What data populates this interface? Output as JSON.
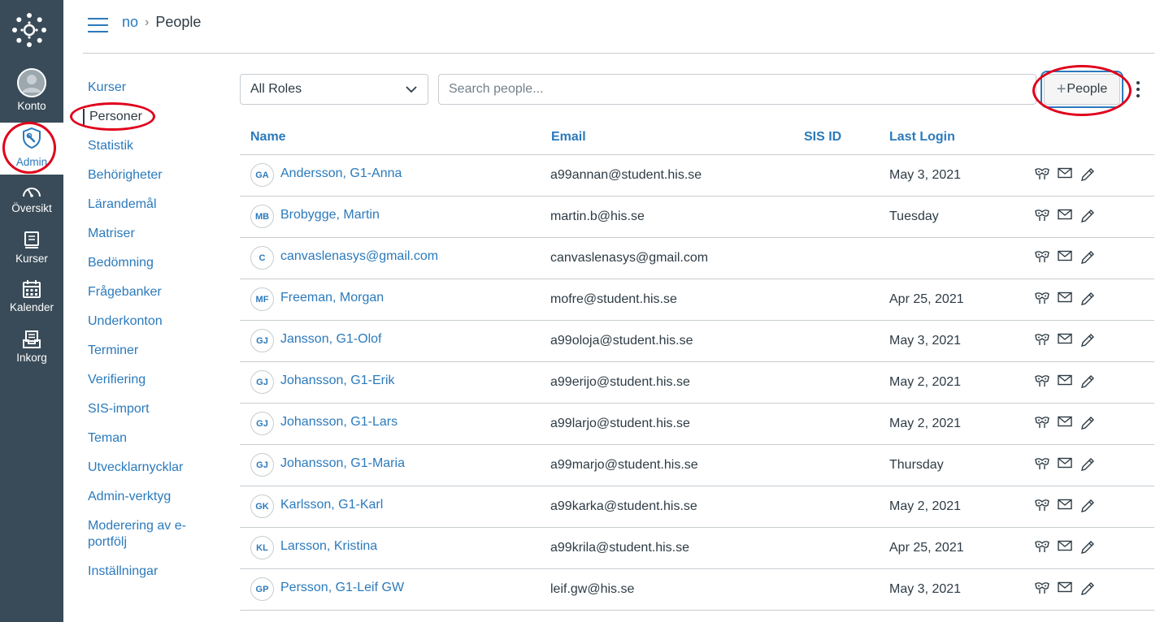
{
  "global_nav": {
    "items": [
      {
        "label": "Konto",
        "icon": "user-avatar-icon"
      },
      {
        "label": "Admin",
        "icon": "admin-shield-icon"
      },
      {
        "label": "Översikt",
        "icon": "dashboard-gauge-icon"
      },
      {
        "label": "Kurser",
        "icon": "courses-book-icon"
      },
      {
        "label": "Kalender",
        "icon": "calendar-icon"
      },
      {
        "label": "Inkorg",
        "icon": "inbox-icon"
      }
    ]
  },
  "breadcrumb": {
    "root": "no",
    "current": "People"
  },
  "sub_nav": {
    "items": [
      {
        "label": "Kurser"
      },
      {
        "label": "Personer",
        "active": true
      },
      {
        "label": "Statistik"
      },
      {
        "label": "Behörigheter"
      },
      {
        "label": "Lärandemål"
      },
      {
        "label": "Matriser"
      },
      {
        "label": "Bedömning"
      },
      {
        "label": "Frågebanker"
      },
      {
        "label": "Underkonton"
      },
      {
        "label": "Terminer"
      },
      {
        "label": "Verifiering"
      },
      {
        "label": "SIS-import"
      },
      {
        "label": "Teman"
      },
      {
        "label": "Utvecklarnycklar"
      },
      {
        "label": "Admin-verktyg"
      },
      {
        "label": "Moderering av e-portfölj"
      },
      {
        "label": "Inställningar"
      }
    ]
  },
  "filters": {
    "roles_selected": "All Roles",
    "search_placeholder": "Search people...",
    "add_button_plus": "+",
    "add_button_label": "People"
  },
  "table": {
    "headers": {
      "name": "Name",
      "email": "Email",
      "sis_id": "SIS ID",
      "last_login": "Last Login"
    },
    "rows": [
      {
        "initials": "GA",
        "name": "Andersson, G1-Anna",
        "email": "a99annan@student.his.se",
        "last_login": "May 3, 2021"
      },
      {
        "initials": "MB",
        "name": "Brobygge, Martin",
        "email": "martin.b@his.se",
        "last_login": "Tuesday"
      },
      {
        "initials": "C",
        "name": "canvaslenasys@gmail.com",
        "email": "canvaslenasys@gmail.com",
        "last_login": ""
      },
      {
        "initials": "MF",
        "name": "Freeman, Morgan",
        "email": "mofre@student.his.se",
        "last_login": "Apr 25, 2021"
      },
      {
        "initials": "GJ",
        "name": "Jansson, G1-Olof",
        "email": "a99oloja@student.his.se",
        "last_login": "May 3, 2021"
      },
      {
        "initials": "GJ",
        "name": "Johansson, G1-Erik",
        "email": "a99erijo@student.his.se",
        "last_login": "May 2, 2021"
      },
      {
        "initials": "GJ",
        "name": "Johansson, G1-Lars",
        "email": "a99larjo@student.his.se",
        "last_login": "May 2, 2021"
      },
      {
        "initials": "GJ",
        "name": "Johansson, G1-Maria",
        "email": "a99marjo@student.his.se",
        "last_login": "Thursday"
      },
      {
        "initials": "GK",
        "name": "Karlsson, G1-Karl",
        "email": "a99karka@student.his.se",
        "last_login": "May 2, 2021"
      },
      {
        "initials": "KL",
        "name": "Larsson, Kristina",
        "email": "a99krila@student.his.se",
        "last_login": "Apr 25, 2021"
      },
      {
        "initials": "GP",
        "name": "Persson, G1-Leif GW",
        "email": "leif.gw@his.se",
        "last_login": "May 3, 2021"
      }
    ],
    "row_actions": [
      "masquerade-icon",
      "message-envelope-icon",
      "edit-pencil-icon"
    ]
  },
  "colors": {
    "nav_bg": "#394b58",
    "link": "#2b7abc",
    "text": "#2d3b45",
    "annotation": "#e0001b"
  }
}
